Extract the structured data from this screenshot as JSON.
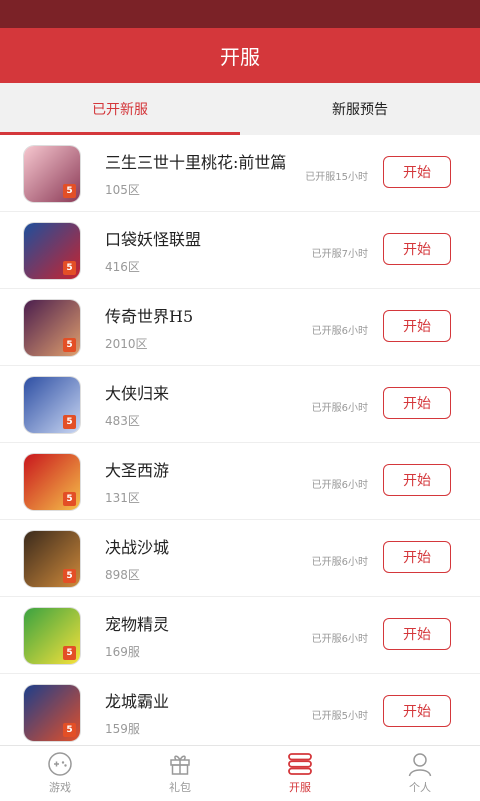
{
  "header": {
    "title": "开服"
  },
  "tabs": [
    {
      "label": "已开新服",
      "active": true
    },
    {
      "label": "新服预告",
      "active": false
    }
  ],
  "servers": [
    {
      "name": "三生三世十里桃花:前世篇",
      "server": "105区",
      "opened": "已开服15小时",
      "button": "开始",
      "thumb_colors": [
        "#f6c7cf",
        "#8b3a57"
      ]
    },
    {
      "name": "口袋妖怪联盟",
      "server": "416区",
      "opened": "已开服7小时",
      "button": "开始",
      "thumb_colors": [
        "#1e4f9c",
        "#c8242f"
      ]
    },
    {
      "name": "传奇世界H5",
      "server": "2010区",
      "opened": "已开服6小时",
      "button": "开始",
      "thumb_colors": [
        "#4b1e4e",
        "#e0a06e"
      ]
    },
    {
      "name": "大侠归来",
      "server": "483区",
      "opened": "已开服6小时",
      "button": "开始",
      "thumb_colors": [
        "#2e4fa3",
        "#c9d6f2"
      ]
    },
    {
      "name": "大圣西游",
      "server": "131区",
      "opened": "已开服6小时",
      "button": "开始",
      "thumb_colors": [
        "#c8161d",
        "#f5c04a"
      ]
    },
    {
      "name": "决战沙城",
      "server": "898区",
      "opened": "已开服6小时",
      "button": "开始",
      "thumb_colors": [
        "#3a2a1c",
        "#d08a3b"
      ]
    },
    {
      "name": "宠物精灵",
      "server": "169服",
      "opened": "已开服6小时",
      "button": "开始",
      "thumb_colors": [
        "#3aa240",
        "#f7e13c"
      ]
    },
    {
      "name": "龙城霸业",
      "server": "159服",
      "opened": "已开服5小时",
      "button": "开始",
      "thumb_colors": [
        "#1d3e8a",
        "#e2502a"
      ]
    }
  ],
  "thumb_badge": "5",
  "nav": [
    {
      "label": "游戏",
      "icon": "gamepad-icon",
      "active": false
    },
    {
      "label": "礼包",
      "icon": "gift-icon",
      "active": false
    },
    {
      "label": "开服",
      "icon": "server-icon",
      "active": true
    },
    {
      "label": "个人",
      "icon": "person-icon",
      "active": false
    }
  ]
}
